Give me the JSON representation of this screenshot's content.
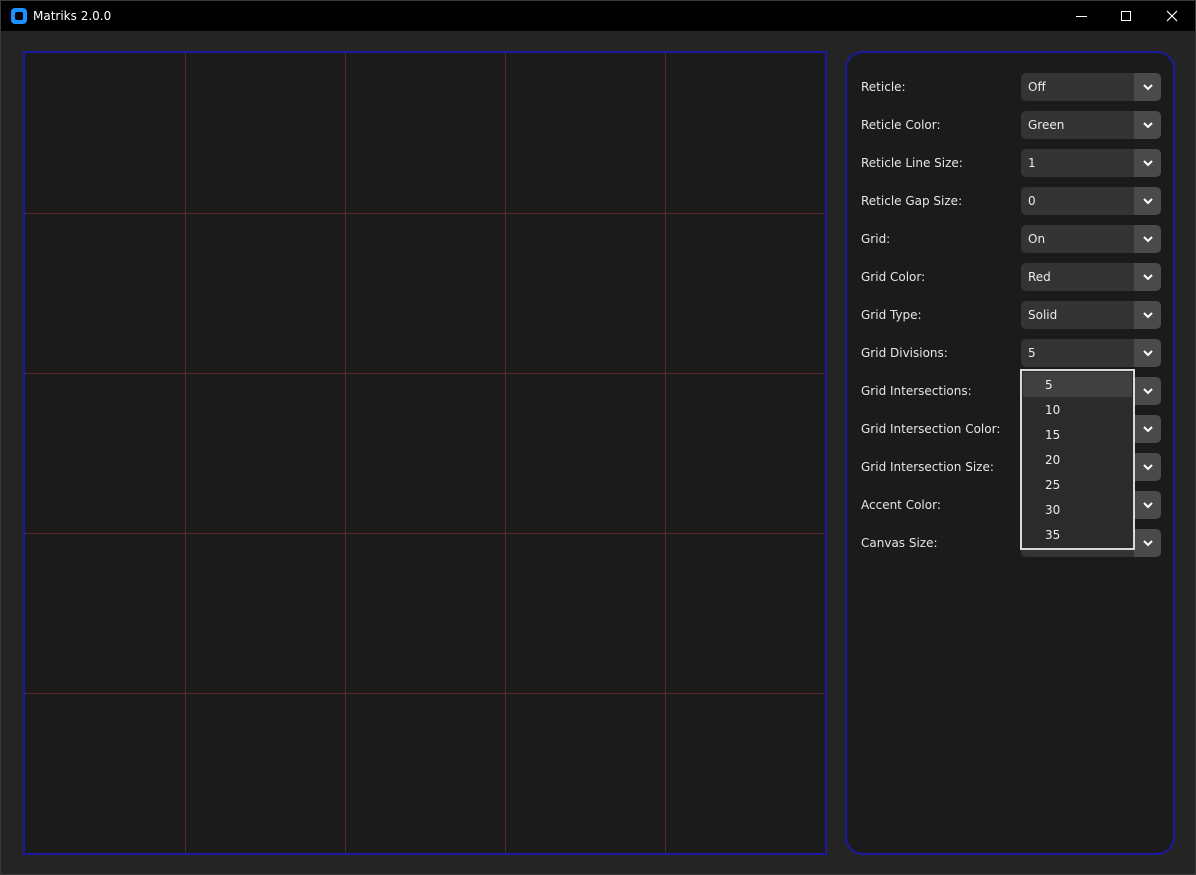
{
  "window": {
    "title": "Matriks 2.0.0"
  },
  "titlebar_buttons": {
    "minimize_icon": "minimize-icon",
    "maximize_icon": "maximize-icon",
    "close_icon": "close-icon"
  },
  "colors": {
    "accent": "#1b1aa0",
    "grid_line": "#5a2a2a",
    "canvas_bg": "#1b1b1b",
    "app_bg": "#242424"
  },
  "canvas": {
    "grid": "On",
    "grid_divisions": 5
  },
  "settings": [
    {
      "label": "Reticle:",
      "value": "Off"
    },
    {
      "label": "Reticle Color:",
      "value": "Green"
    },
    {
      "label": "Reticle Line Size:",
      "value": "1"
    },
    {
      "label": "Reticle Gap Size:",
      "value": "0"
    },
    {
      "label": "Grid:",
      "value": "On"
    },
    {
      "label": "Grid Color:",
      "value": "Red"
    },
    {
      "label": "Grid Type:",
      "value": "Solid"
    },
    {
      "label": "Grid Divisions:",
      "value": "5"
    },
    {
      "label": "Grid Intersections:",
      "value": ""
    },
    {
      "label": "Grid Intersection Color:",
      "value": ""
    },
    {
      "label": "Grid Intersection Size:",
      "value": ""
    },
    {
      "label": "Accent Color:",
      "value": ""
    },
    {
      "label": "Canvas Size:",
      "value": ""
    }
  ],
  "open_dropdown": {
    "for": "Grid Divisions:",
    "options": [
      "5",
      "10",
      "15",
      "20",
      "25",
      "30",
      "35"
    ],
    "highlighted": "5"
  }
}
